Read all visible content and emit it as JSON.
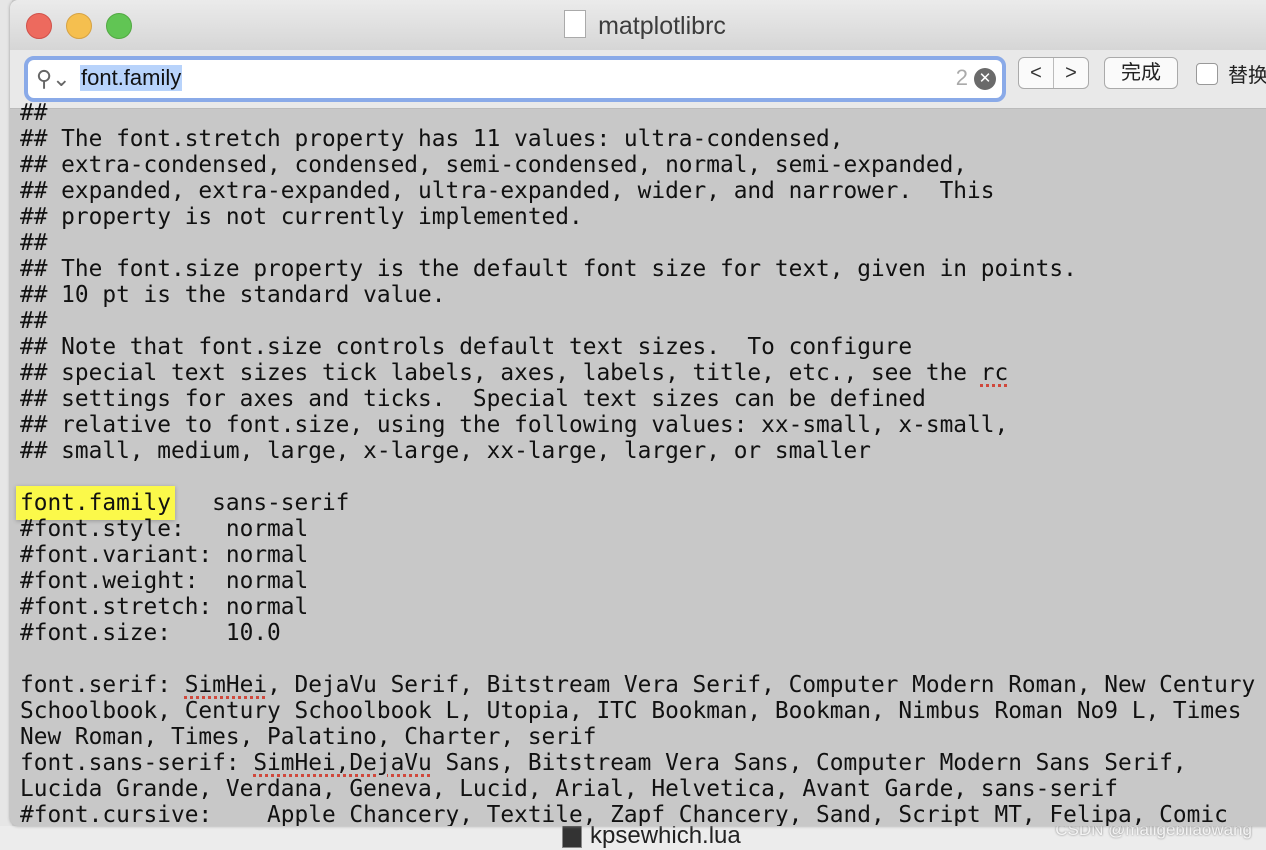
{
  "window": {
    "title": "matplotlibrc"
  },
  "findbar": {
    "query": "font.family",
    "match_count": "2",
    "prev": "<",
    "next": ">",
    "done_label": "完成",
    "replace_label": "替换"
  },
  "desktop": {
    "file_label": "kpsewhich.lua",
    "watermark": "CSDN @maligebilaowang"
  },
  "colors": {
    "highlight": "#fbf94a",
    "search_focus": "#8aaae8",
    "editor_bg": "#c8c8c8"
  },
  "editor": {
    "lines": [
      [
        {
          "t": "##"
        }
      ],
      [
        {
          "t": "## The font.stretch property has 11 values: ultra-condensed,"
        }
      ],
      [
        {
          "t": "## extra-condensed, condensed, semi-condensed, normal, semi-expanded,"
        }
      ],
      [
        {
          "t": "## expanded, extra-expanded, ultra-expanded, wider, and narrower.  This"
        }
      ],
      [
        {
          "t": "## property is not currently implemented."
        }
      ],
      [
        {
          "t": "##"
        }
      ],
      [
        {
          "t": "## The font.size property is the default font size for text, given in points."
        }
      ],
      [
        {
          "t": "## 10 pt is the standard value."
        }
      ],
      [
        {
          "t": "##"
        }
      ],
      [
        {
          "t": "## Note that font.size controls default text sizes.  To configure"
        }
      ],
      [
        {
          "t": "## special text sizes tick labels, axes, labels, title, etc., see the "
        },
        {
          "t": "rc",
          "spell": true
        }
      ],
      [
        {
          "t": "## settings for axes and ticks.  Special text sizes can be defined"
        }
      ],
      [
        {
          "t": "## relative to font.size, using the following values: xx-small, x-small,"
        }
      ],
      [
        {
          "t": "## small, medium, large, x-large, xx-large, larger, or smaller"
        }
      ],
      [
        {
          "t": ""
        }
      ],
      [
        {
          "t": "font.family",
          "hl": true
        },
        {
          "t": "   sans-serif"
        }
      ],
      [
        {
          "t": "#font.style:   normal"
        }
      ],
      [
        {
          "t": "#font.variant: normal"
        }
      ],
      [
        {
          "t": "#font.weight:  normal"
        }
      ],
      [
        {
          "t": "#font.stretch: normal"
        }
      ],
      [
        {
          "t": "#font.size:    10.0"
        }
      ],
      [
        {
          "t": ""
        }
      ],
      [
        {
          "t": "font.serif: "
        },
        {
          "t": "SimHei",
          "spell": true
        },
        {
          "t": ", DejaVu Serif, Bitstream Vera Serif, Computer Modern Roman, New Century"
        }
      ],
      [
        {
          "t": "Schoolbook, Century Schoolbook L, Utopia, ITC Bookman, Bookman, Nimbus Roman No9 L, Times"
        }
      ],
      [
        {
          "t": "New Roman, Times, Palatino, Charter, serif"
        }
      ],
      [
        {
          "t": "font.sans-serif: "
        },
        {
          "t": "SimHei,DejaVu",
          "spell": true
        },
        {
          "t": " Sans, Bitstream Vera Sans, Computer Modern Sans Serif,"
        }
      ],
      [
        {
          "t": "Lucida Grande, Verdana, Geneva, Lucid, Arial, Helvetica, Avant Garde, sans-serif"
        }
      ],
      [
        {
          "t": "#font.cursive:    Apple Chancery, Textile, Zapf Chancery, Sand, Script MT, Felipa, Comic"
        }
      ]
    ]
  }
}
